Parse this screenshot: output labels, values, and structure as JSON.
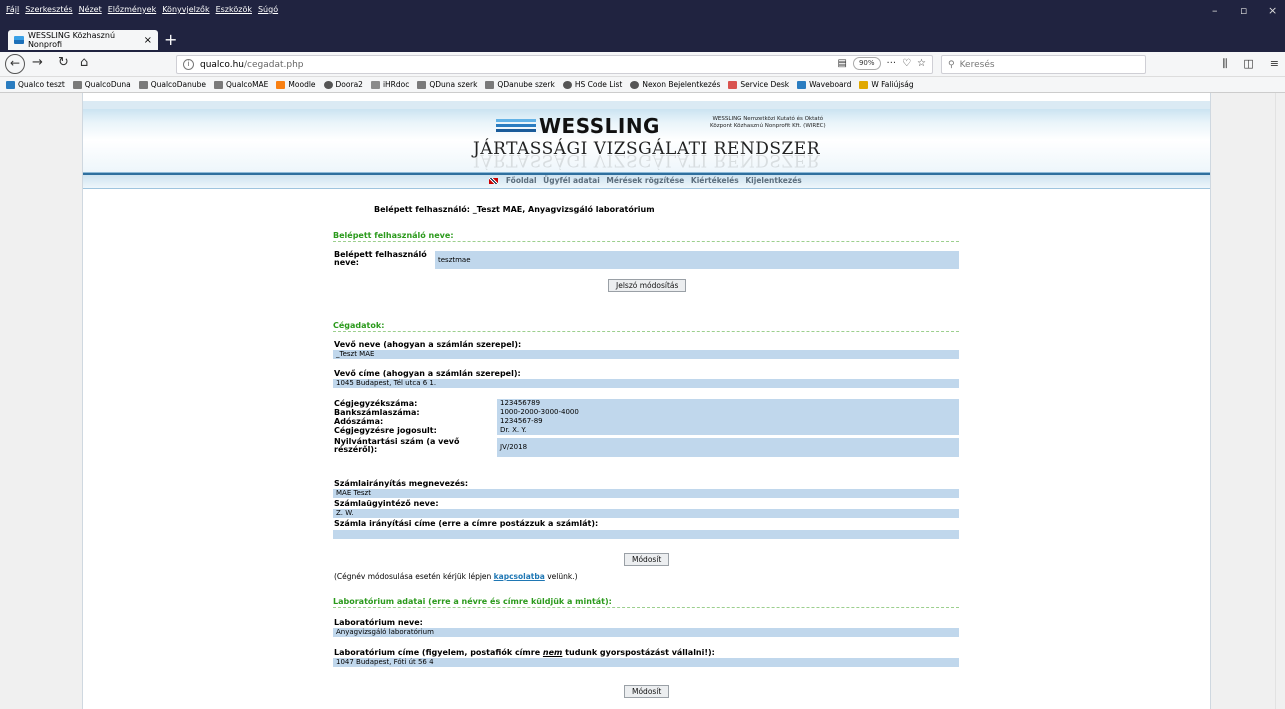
{
  "browser": {
    "menu": [
      "Fájl",
      "Szerkesztés",
      "Nézet",
      "Előzmények",
      "Könyvjelzők",
      "Eszközök",
      "Súgó"
    ],
    "window_controls": [
      "–",
      "▫",
      "×"
    ],
    "tab_title": "WESSLING Közhasznú Nonprofi",
    "tab_close": "×",
    "new_tab": "+",
    "url_host": "qualco.hu",
    "url_path": "/cegadat.php",
    "zoom": "90%",
    "search_placeholder": "Keresés",
    "bookmarks": [
      {
        "label": "Qualco teszt",
        "icon": "wessling-icon",
        "color": "#2a7cc0"
      },
      {
        "label": "QualcoDuna",
        "icon": "qualco-icon",
        "color": "#7a7a7a"
      },
      {
        "label": "QualcoDanube",
        "icon": "qualco-icon",
        "color": "#7a7a7a"
      },
      {
        "label": "QualcoMAE",
        "icon": "qualco-icon",
        "color": "#7a7a7a"
      },
      {
        "label": "Moodle",
        "icon": "moodle-icon",
        "color": "#f98012"
      },
      {
        "label": "Doora2",
        "icon": "globe-icon",
        "color": "#555555"
      },
      {
        "label": "iHRdoc",
        "icon": "image-icon",
        "color": "#8a8a8a"
      },
      {
        "label": "QDuna szerk",
        "icon": "qualco-icon",
        "color": "#7a7a7a"
      },
      {
        "label": "QDanube szerk",
        "icon": "qualco-icon",
        "color": "#7a7a7a"
      },
      {
        "label": "HS Code List",
        "icon": "globe-icon",
        "color": "#555555"
      },
      {
        "label": "Nexon Bejelentkezés",
        "icon": "globe-icon",
        "color": "#555555"
      },
      {
        "label": "Service Desk",
        "icon": "service-icon",
        "color": "#d9534f"
      },
      {
        "label": "Waveboard",
        "icon": "wessling-icon",
        "color": "#2a7cc0"
      },
      {
        "label": "W Faliújság",
        "icon": "faliujsag-icon",
        "color": "#e0a800"
      }
    ]
  },
  "site": {
    "logo_text": "WESSLING",
    "logo_sub_1": "WESSLING Nemzetközi Kutató és Oktató",
    "logo_sub_2": "Központ Közhasznú Nonprofit Kft. (WIREC)",
    "title": "JÁRTASSÁGI VIZSGÁLATI RENDSZER",
    "nav": [
      "Főoldal",
      "Ügyfél adatai",
      "Mérések rögzítése",
      "Kiértékelés",
      "Kijelentkezés"
    ]
  },
  "page": {
    "logged_in": "Belépett felhasználó: _Teszt MAE, Anyagvizsgáló laboratórium",
    "section_user": "Belépett felhasználó neve:",
    "user_label": "Belépett felhasználó neve:",
    "user_value": "tesztmae",
    "password_button": "Jelszó módosítás",
    "section_company": "Cégadatok:",
    "buyer_name_label": "Vevő neve (ahogyan a számlán szerepel):",
    "buyer_name_value": "_Teszt MAE",
    "buyer_address_label": "Vevő címe (ahogyan a számlán szerepel):",
    "buyer_address_value": "1045 Budapest, Tél utca 6 1.",
    "company_fields": [
      {
        "label": "Cégjegyzékszáma:",
        "value": "123456789"
      },
      {
        "label": "Bankszámlaszáma:",
        "value": "1000-2000-3000-4000"
      },
      {
        "label": "Adószáma:",
        "value": "1234567-89"
      },
      {
        "label": "Cégjegyzésre jogosult:",
        "value": "Dr. X. Y."
      },
      {
        "label": "Nyilvántartási szám (a vevő részéről):",
        "value": "JV/2018"
      }
    ],
    "billing_name_label": "Számlairányítás megnevezés:",
    "billing_name_value": "MAE Teszt",
    "billing_admin_label": "Számlaügyintéző neve:",
    "billing_admin_value": "Z. W.",
    "billing_address_label": "Számla irányítási címe (erre a címre postázzuk a számlát):",
    "billing_address_value": "",
    "modify_button": "Módosít",
    "note_before": "(Cégnév módosulása esetén kérjük lépjen ",
    "note_link": "kapcsolatba",
    "note_after": " velünk.)",
    "section_lab": "Laboratórium adatai (erre a névre és címre küldjük a mintát):",
    "lab_name_label": "Laboratórium neve:",
    "lab_name_value": "Anyagvizsgáló laboratórium",
    "lab_address_label_before": "Laboratórium címe (figyelem, postafiók címre ",
    "lab_address_label_em": "nem",
    "lab_address_label_after": " tudunk gyorspostázást vállalni!):",
    "lab_address_value": "1047 Budapest, Fóti út 56 4",
    "modify_button_2": "Módosít"
  }
}
